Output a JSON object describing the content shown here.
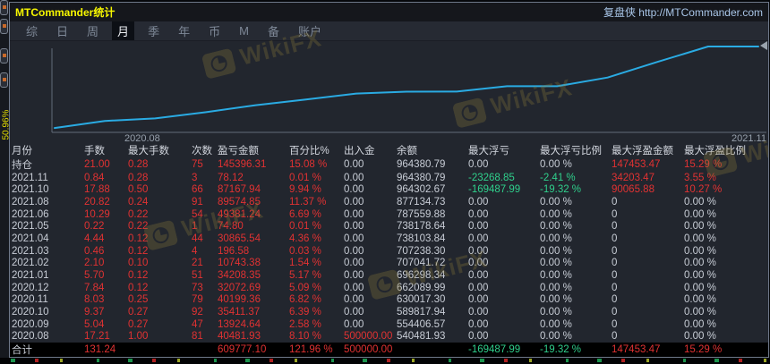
{
  "window": {
    "title": "MTCommander统计",
    "brand": "复盘侠 http://MTCommander.com"
  },
  "background_fragment": {
    "side_label": "50.96%"
  },
  "menu": {
    "items": [
      "综",
      "日",
      "周",
      "月",
      "季",
      "年",
      "币",
      "M",
      "备",
      "账户"
    ],
    "selected": "月"
  },
  "watermark": {
    "text": "WikiFX"
  },
  "chart_data": {
    "type": "line",
    "name": "账户余额曲线",
    "line_color": "#2aabe3",
    "grid": false,
    "legend": "none",
    "x_axis_labels": [
      "2020.08",
      "2021.11"
    ],
    "start_value": 500000.0,
    "x": [
      "2020.08",
      "2020.09",
      "2020.10",
      "2020.11",
      "2020.12",
      "2021.01",
      "2021.02",
      "2021.03",
      "2021.04",
      "2021.05",
      "2021.06",
      "2021.08",
      "2021.10",
      "2021.11"
    ],
    "values": [
      540481.93,
      554406.57,
      589817.94,
      630017.3,
      662089.99,
      696298.34,
      707041.72,
      707238.3,
      738103.84,
      738178.64,
      787559.88,
      877134.73,
      964302.67,
      964380.79
    ],
    "ylim": [
      475000,
      995000
    ]
  },
  "table": {
    "headers": [
      "月份",
      "手数",
      "最大手数",
      "次数",
      "盈亏金额",
      "百分比%",
      "出入金",
      "余额",
      "最大浮亏",
      "最大浮亏比例",
      "最大浮盈金额",
      "最大浮盈比例"
    ],
    "rows": [
      {
        "cells": [
          "持仓",
          "21.00",
          "0.28",
          "75",
          "145396.31",
          "15.08 %",
          "0.00",
          "964380.79",
          "0.00",
          "0.00 %",
          "147453.47",
          "15.29 %"
        ],
        "styles": [
          "w",
          "r",
          "r",
          "r",
          "r",
          "r",
          "w",
          "w",
          "w",
          "w",
          "r",
          "r"
        ]
      },
      {
        "cells": [
          "2021.11",
          "0.84",
          "0.28",
          "3",
          "78.12",
          "0.01 %",
          "0.00",
          "964380.79",
          "-23268.85",
          "-2.41 %",
          "34203.47",
          "3.55 %"
        ],
        "styles": [
          "w",
          "r",
          "r",
          "r",
          "r",
          "r",
          "w",
          "w",
          "g",
          "g",
          "r",
          "r"
        ]
      },
      {
        "cells": [
          "2021.10",
          "17.88",
          "0.50",
          "66",
          "87167.94",
          "9.94 %",
          "0.00",
          "964302.67",
          "-169487.99",
          "-19.32 %",
          "90065.88",
          "10.27 %"
        ],
        "styles": [
          "w",
          "r",
          "r",
          "r",
          "r",
          "r",
          "w",
          "w",
          "g",
          "g",
          "r",
          "r"
        ]
      },
      {
        "cells": [
          "2021.08",
          "20.82",
          "0.24",
          "91",
          "89574.85",
          "11.37 %",
          "0.00",
          "877134.73",
          "0.00",
          "0.00 %",
          "0",
          "0.00 %"
        ],
        "styles": [
          "w",
          "r",
          "r",
          "r",
          "r",
          "r",
          "w",
          "w",
          "w",
          "w",
          "w",
          "w"
        ]
      },
      {
        "cells": [
          "2021.06",
          "10.29",
          "0.22",
          "54",
          "49381.24",
          "6.69 %",
          "0.00",
          "787559.88",
          "0.00",
          "0.00 %",
          "0",
          "0.00 %"
        ],
        "styles": [
          "w",
          "r",
          "r",
          "r",
          "r",
          "r",
          "w",
          "w",
          "w",
          "w",
          "w",
          "w"
        ]
      },
      {
        "cells": [
          "2021.05",
          "0.22",
          "0.22",
          "1",
          "74.80",
          "0.01 %",
          "0.00",
          "738178.64",
          "0.00",
          "0.00 %",
          "0",
          "0.00 %"
        ],
        "styles": [
          "w",
          "r",
          "r",
          "r",
          "r",
          "r",
          "w",
          "w",
          "w",
          "w",
          "w",
          "w"
        ]
      },
      {
        "cells": [
          "2021.04",
          "4.44",
          "0.12",
          "44",
          "30865.54",
          "4.36 %",
          "0.00",
          "738103.84",
          "0.00",
          "0.00 %",
          "0",
          "0.00 %"
        ],
        "styles": [
          "w",
          "r",
          "r",
          "r",
          "r",
          "r",
          "w",
          "w",
          "w",
          "w",
          "w",
          "w"
        ]
      },
      {
        "cells": [
          "2021.03",
          "0.46",
          "0.12",
          "4",
          "196.58",
          "0.03 %",
          "0.00",
          "707238.30",
          "0.00",
          "0.00 %",
          "0",
          "0.00 %"
        ],
        "styles": [
          "w",
          "r",
          "r",
          "r",
          "r",
          "r",
          "w",
          "w",
          "w",
          "w",
          "w",
          "w"
        ]
      },
      {
        "cells": [
          "2021.02",
          "2.10",
          "0.10",
          "21",
          "10743.38",
          "1.54 %",
          "0.00",
          "707041.72",
          "0.00",
          "0.00 %",
          "0",
          "0.00 %"
        ],
        "styles": [
          "w",
          "r",
          "r",
          "r",
          "r",
          "r",
          "w",
          "w",
          "w",
          "w",
          "w",
          "w"
        ]
      },
      {
        "cells": [
          "2021.01",
          "5.70",
          "0.12",
          "51",
          "34208.35",
          "5.17 %",
          "0.00",
          "696298.34",
          "0.00",
          "0.00 %",
          "0",
          "0.00 %"
        ],
        "styles": [
          "w",
          "r",
          "r",
          "r",
          "r",
          "r",
          "w",
          "w",
          "w",
          "w",
          "w",
          "w"
        ]
      },
      {
        "cells": [
          "2020.12",
          "7.84",
          "0.12",
          "73",
          "32072.69",
          "5.09 %",
          "0.00",
          "662089.99",
          "0.00",
          "0.00 %",
          "0",
          "0.00 %"
        ],
        "styles": [
          "w",
          "r",
          "r",
          "r",
          "r",
          "r",
          "w",
          "w",
          "w",
          "w",
          "w",
          "w"
        ]
      },
      {
        "cells": [
          "2020.11",
          "8.03",
          "0.25",
          "79",
          "40199.36",
          "6.82 %",
          "0.00",
          "630017.30",
          "0.00",
          "0.00 %",
          "0",
          "0.00 %"
        ],
        "styles": [
          "w",
          "r",
          "r",
          "r",
          "r",
          "r",
          "w",
          "w",
          "w",
          "w",
          "w",
          "w"
        ]
      },
      {
        "cells": [
          "2020.10",
          "9.37",
          "0.27",
          "92",
          "35411.37",
          "6.39 %",
          "0.00",
          "589817.94",
          "0.00",
          "0.00 %",
          "0",
          "0.00 %"
        ],
        "styles": [
          "w",
          "r",
          "r",
          "r",
          "r",
          "r",
          "w",
          "w",
          "w",
          "w",
          "w",
          "w"
        ]
      },
      {
        "cells": [
          "2020.09",
          "5.04",
          "0.27",
          "47",
          "13924.64",
          "2.58 %",
          "0.00",
          "554406.57",
          "0.00",
          "0.00 %",
          "0",
          "0.00 %"
        ],
        "styles": [
          "w",
          "r",
          "r",
          "r",
          "r",
          "r",
          "w",
          "w",
          "w",
          "w",
          "w",
          "w"
        ]
      },
      {
        "cells": [
          "2020.08",
          "17.21",
          "1.00",
          "81",
          "40481.93",
          "8.10 %",
          "500000.00",
          "540481.93",
          "0.00",
          "0.00 %",
          "0",
          "0.00 %"
        ],
        "styles": [
          "w",
          "r",
          "r",
          "r",
          "r",
          "r",
          "r",
          "w",
          "w",
          "w",
          "w",
          "w"
        ]
      },
      {
        "cells": [
          "合计",
          "131.24",
          "",
          "",
          "609777.10",
          "121.96 %",
          "500000.00",
          "",
          "-169487.99",
          "-19.32 %",
          "147453.47",
          "15.29 %"
        ],
        "styles": [
          "w",
          "r",
          "w",
          "w",
          "r",
          "r",
          "r",
          "w",
          "g",
          "g",
          "r",
          "r"
        ],
        "total": true
      }
    ]
  }
}
